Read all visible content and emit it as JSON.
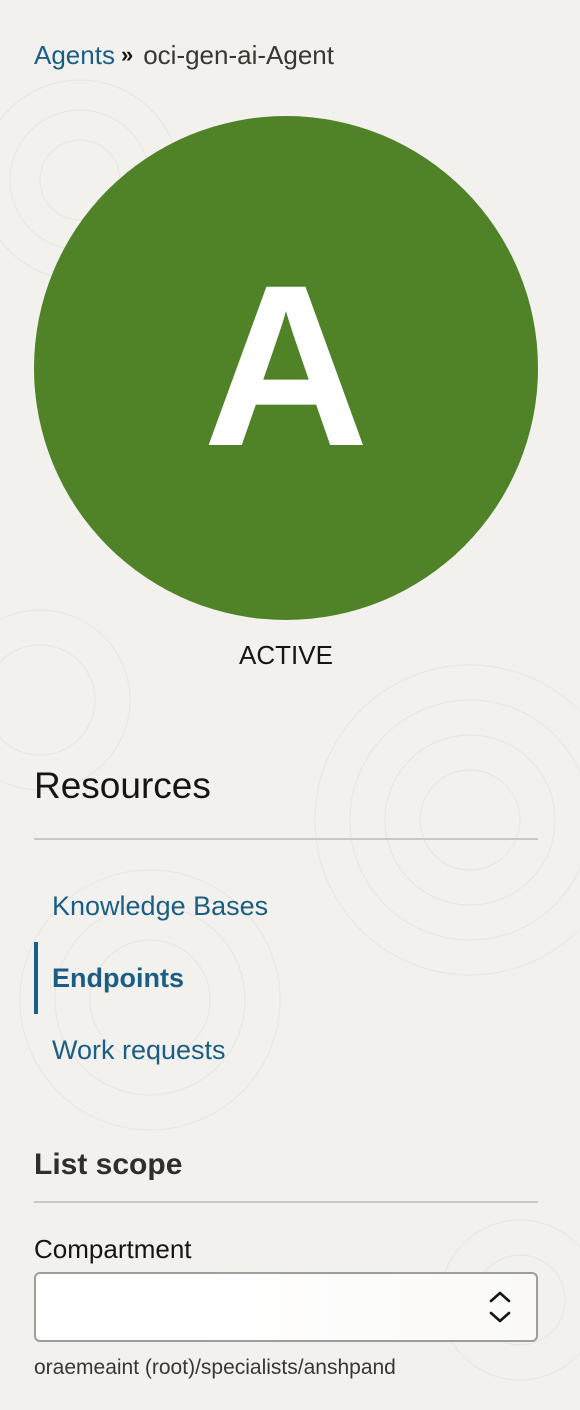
{
  "breadcrumb": {
    "parent": "Agents",
    "separator": "»",
    "current": "oci-gen-ai-Agent"
  },
  "avatar": {
    "letter": "A",
    "color": "#508327"
  },
  "status": "ACTIVE",
  "resources": {
    "title": "Resources",
    "items": [
      {
        "label": "Knowledge Bases",
        "active": false
      },
      {
        "label": "Endpoints",
        "active": true
      },
      {
        "label": "Work requests",
        "active": false
      }
    ]
  },
  "list_scope": {
    "title": "List scope",
    "compartment_label": "Compartment",
    "compartment_value": "",
    "compartment_icon": "chevron-up-down-icon",
    "compartment_path": "oraemeaint (root)/specialists/anshpand"
  },
  "colors": {
    "link": "#1b5e85",
    "background": "#f2f1ed",
    "avatar": "#508327"
  }
}
